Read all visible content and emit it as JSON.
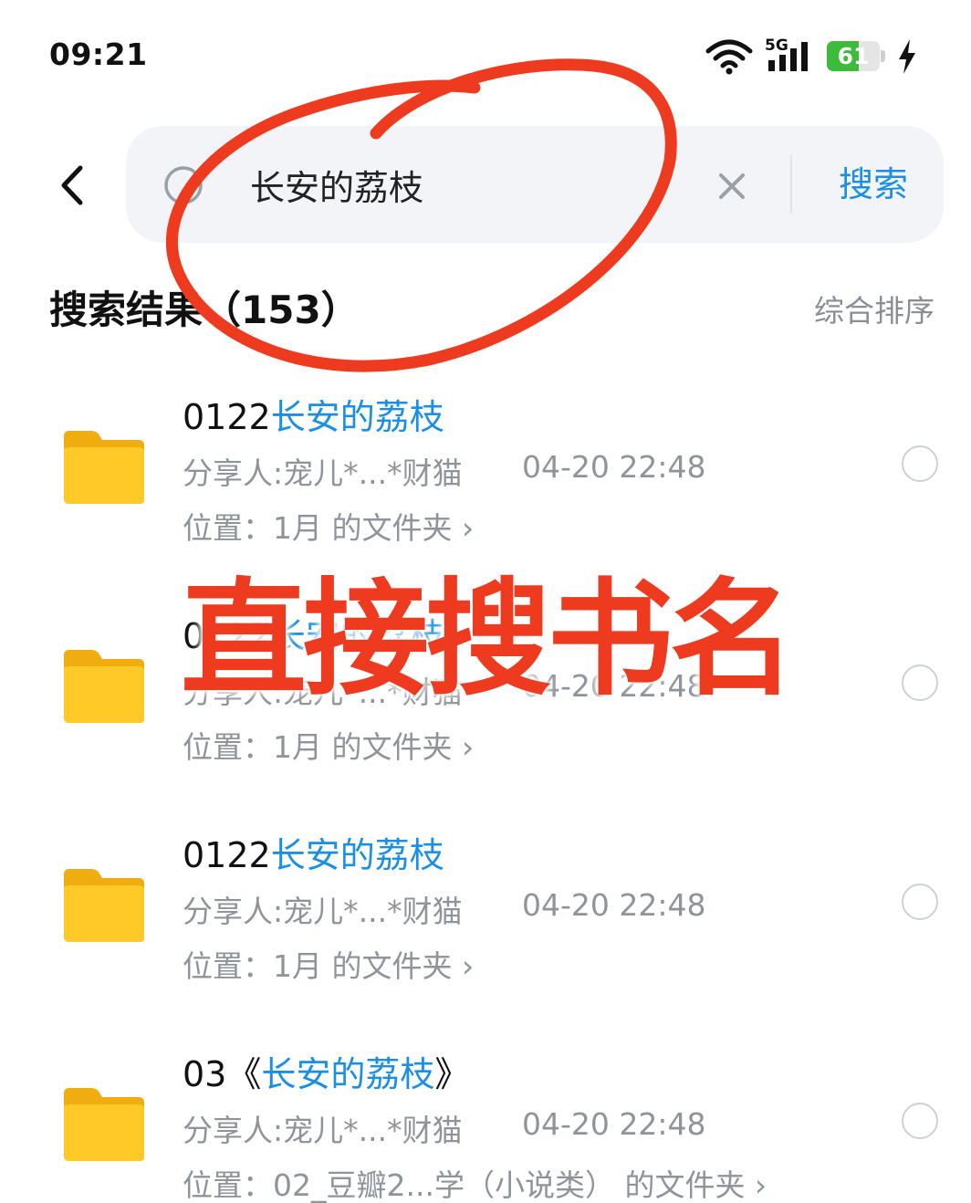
{
  "status_bar": {
    "time": "09:21",
    "network": "5G",
    "battery_percent": 61,
    "battery_label": "61"
  },
  "search": {
    "query": "长安的荔枝",
    "button_label": "搜索"
  },
  "results": {
    "title": "搜索结果（153）",
    "sort_label": "综合排序",
    "items": [
      {
        "prefix": "0122",
        "highlight": "长安的荔枝",
        "suffix": "",
        "sharer": "分享人:宠儿*...*财猫",
        "date": "04-20 22:48",
        "location": "位置：1月 的文件夹 ›"
      },
      {
        "prefix": "0122",
        "highlight": "长安的荔枝",
        "suffix": "",
        "sharer": "分享人:宠儿*...*财猫",
        "date": "04-20 22:48",
        "location": "位置：1月 的文件夹 ›"
      },
      {
        "prefix": "0122",
        "highlight": "长安的荔枝",
        "suffix": "",
        "sharer": "分享人:宠儿*...*财猫",
        "date": "04-20 22:48",
        "location": "位置：1月 的文件夹 ›"
      },
      {
        "prefix": "03《",
        "highlight": "长安的荔枝",
        "suffix": "》",
        "sharer": "分享人:宠儿*...*财猫",
        "date": "04-20 22:48",
        "location": "位置：02_豆瓣2...学（小说类） 的文件夹 ›"
      }
    ]
  },
  "annotation": {
    "caption": "直接搜书名",
    "color": "#ee3b1f"
  },
  "colors": {
    "accent": "#1b8fe6",
    "meta_text": "#8f949b",
    "folder": "#ffc928",
    "battery": "#3dbb3a"
  }
}
